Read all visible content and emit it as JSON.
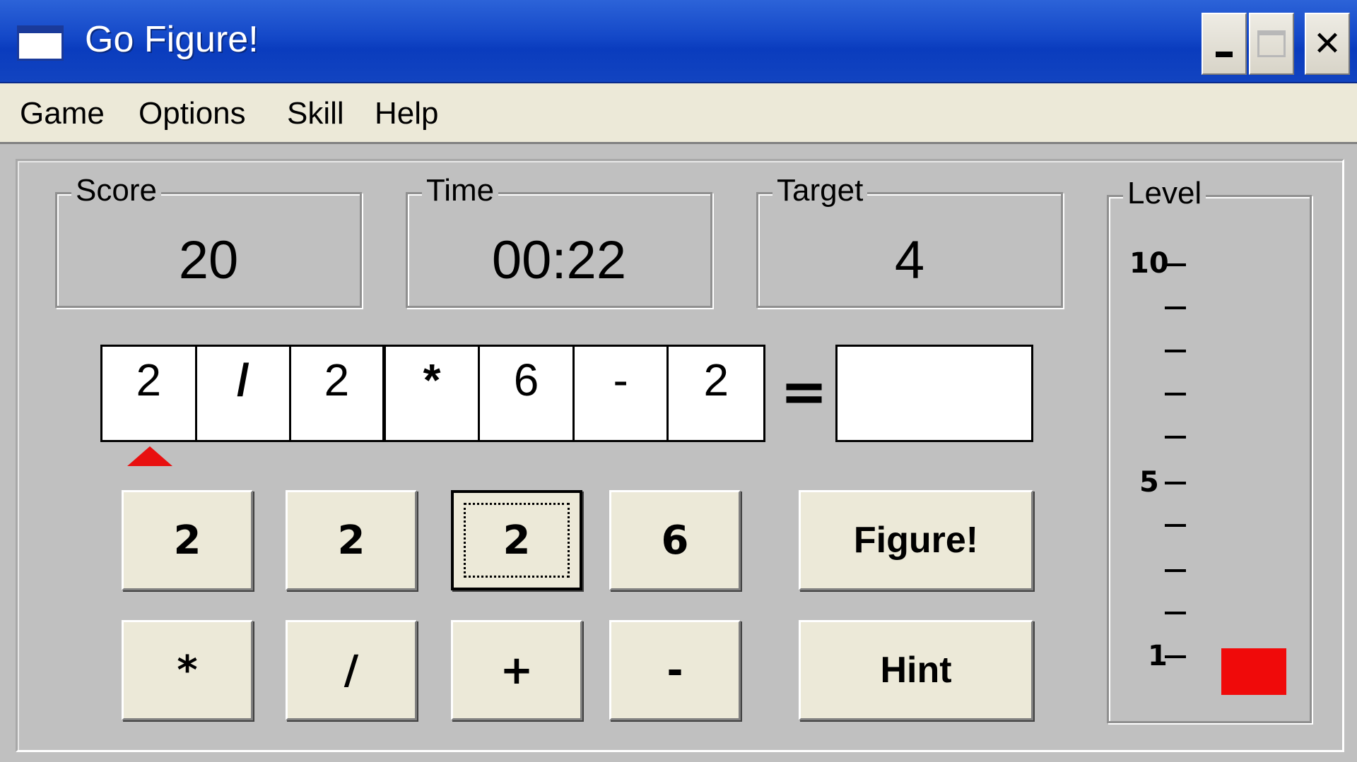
{
  "window": {
    "title": "Go Figure!",
    "controls": {
      "minimize": "minimize",
      "maximize": "maximize",
      "close": "✕"
    }
  },
  "menu": {
    "items": [
      "Game",
      "Options",
      "Skill",
      "Help"
    ]
  },
  "stats": {
    "score_label": "Score",
    "score": "20",
    "time_label": "Time",
    "time": "00:22",
    "target_label": "Target",
    "target": "4"
  },
  "expression": {
    "cells": [
      "2",
      "/",
      "2",
      "*",
      "6",
      "-",
      "2"
    ],
    "equals": "=",
    "result": ""
  },
  "number_buttons": [
    "2",
    "2",
    "2",
    "6"
  ],
  "operator_buttons": [
    "*",
    "/",
    "+",
    "-"
  ],
  "actions": {
    "figure": "Figure!",
    "hint": "Hint"
  },
  "level": {
    "label": "Level",
    "tick_labels": {
      "top": "10",
      "middle": "5",
      "bottom": "1"
    },
    "current": 1,
    "marker_color": "#f00a0a"
  },
  "colors": {
    "titlebar": "#1448c8",
    "face": "#c0c0c0",
    "button": "#ece9d8",
    "accent": "#e81010"
  }
}
